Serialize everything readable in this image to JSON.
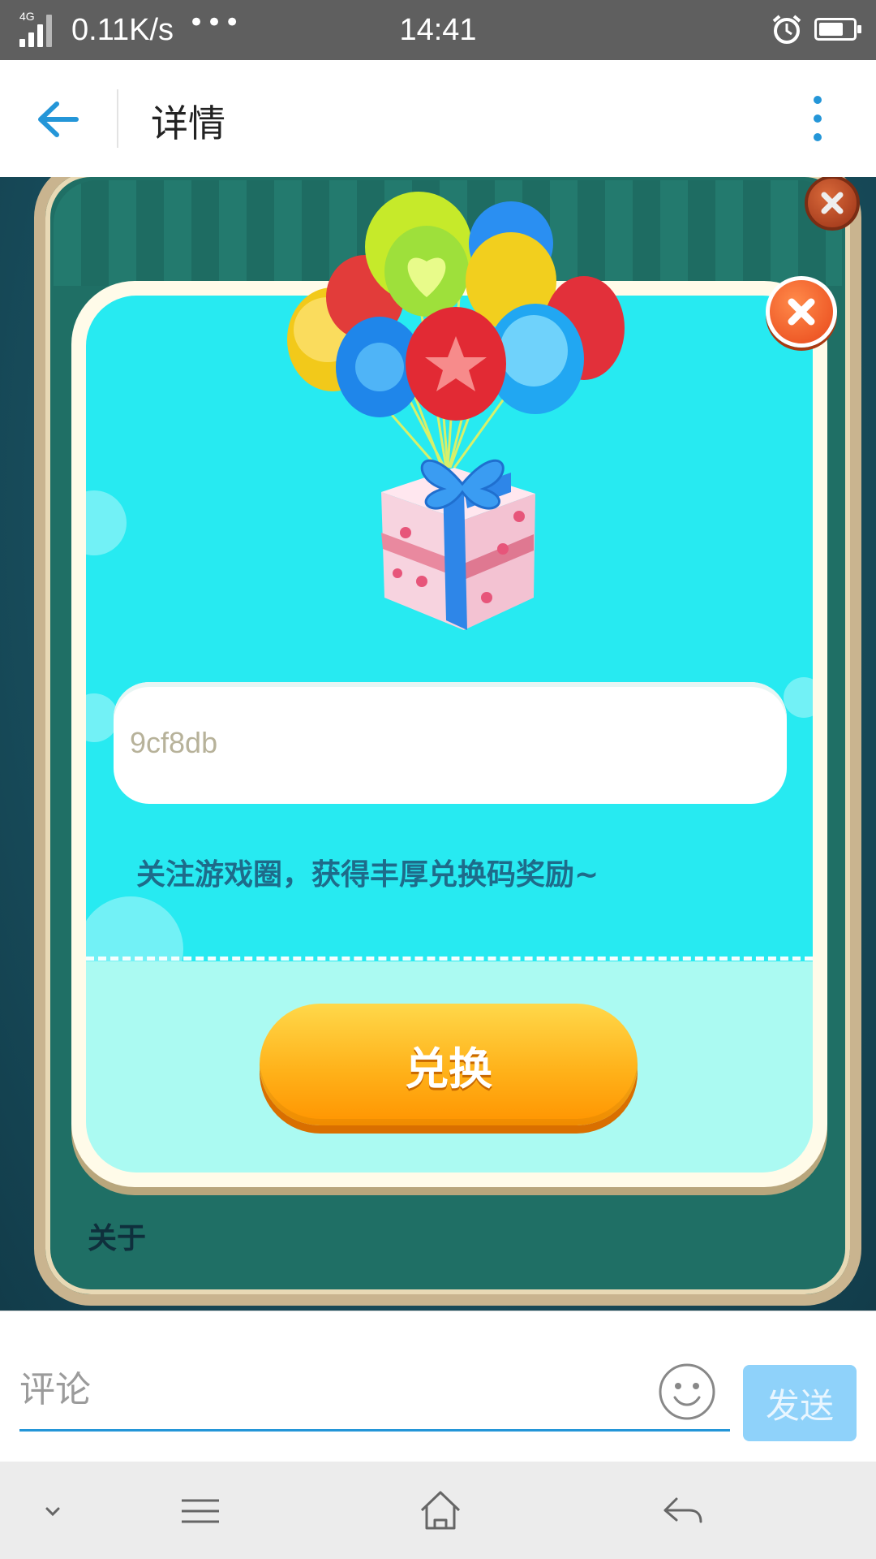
{
  "status_bar": {
    "network_type": "4G",
    "speed": "0.11K/s",
    "more_dots": "•••",
    "time": "14:41",
    "battery_level": 0.72
  },
  "app_bar": {
    "title": "详情",
    "accent_color": "#2496d8"
  },
  "game_dialog": {
    "code_value": "9cf8db",
    "hint": "关注游戏圈，获得丰厚兑换码奖励~",
    "redeem_label": "兑换",
    "about_label": "关于"
  },
  "comment_bar": {
    "placeholder": "评论",
    "send_label": "发送",
    "emoji_icon": "smiley-icon"
  },
  "nav_bar": {
    "items": [
      "chevron-down-icon",
      "menu-icon",
      "home-icon",
      "back-icon"
    ]
  }
}
